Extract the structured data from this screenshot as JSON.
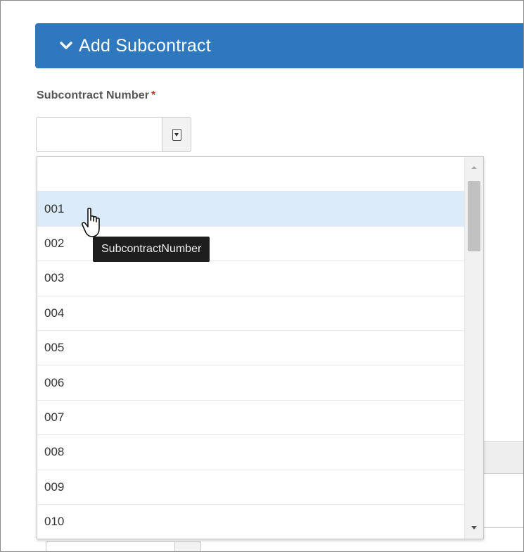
{
  "panel": {
    "title": "Add Subcontract",
    "color": "#2f78bd"
  },
  "field": {
    "label": "Subcontract Number",
    "required_marker": "*",
    "value": ""
  },
  "dropdown": {
    "options": [
      "",
      "001",
      "002",
      "003",
      "004",
      "005",
      "006",
      "007",
      "008",
      "009",
      "010"
    ],
    "highlighted_option": "001",
    "highlight_color": "#dcebfa"
  },
  "tooltip": {
    "text": "SubcontractNumber"
  },
  "icons": {
    "panel_chevron": "chevron-down-icon",
    "combo_button": "dropdown-arrow-icon",
    "cursor": "hand-pointer-icon"
  }
}
